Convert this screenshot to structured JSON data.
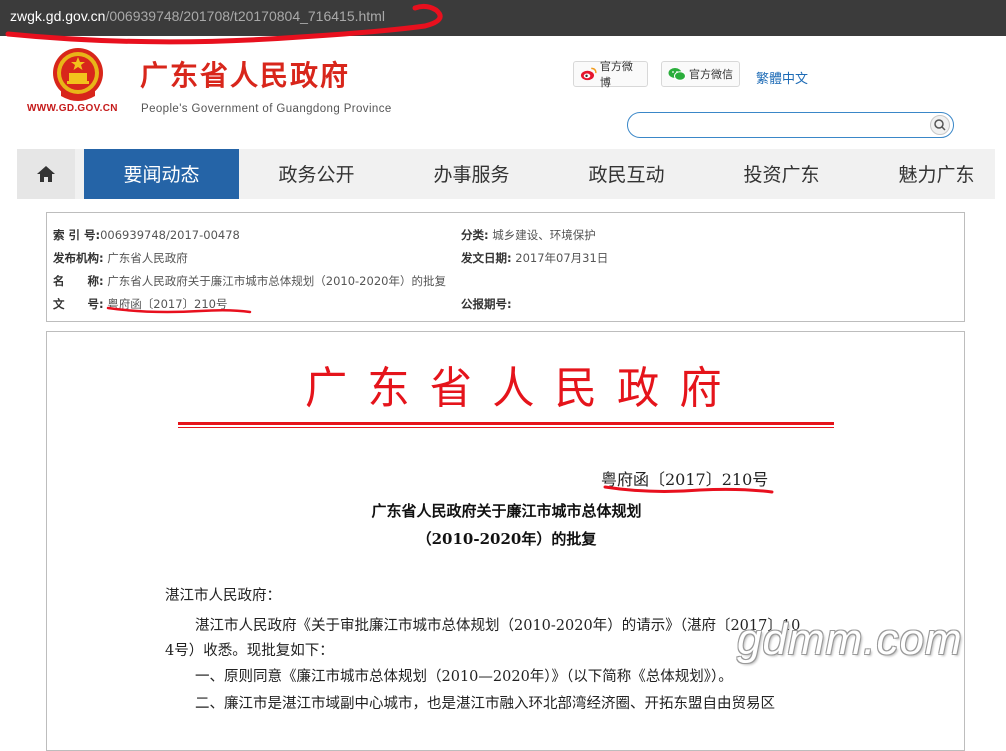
{
  "browser": {
    "url_host": "zwgk.gd.gov.cn",
    "url_path": "/006939748/201708/t20170804_716415.html"
  },
  "header": {
    "site_url": "WWW.GD.GOV.CN",
    "title": "广东省人民政府",
    "subtitle": "People's Government of Guangdong Province",
    "weibo_label": "官方微博",
    "weixin_label": "官方微信",
    "lang_link": "繁體中文",
    "search": {
      "value": "",
      "placeholder": ""
    }
  },
  "nav": {
    "items": [
      {
        "label": "要闻动态",
        "active": true
      },
      {
        "label": "政务公开",
        "active": false
      },
      {
        "label": "办事服务",
        "active": false
      },
      {
        "label": "政民互动",
        "active": false
      },
      {
        "label": "投资广东",
        "active": false
      },
      {
        "label": "魅力广东",
        "active": false
      }
    ]
  },
  "meta": {
    "index_key": "索 引 号:",
    "index_val": "006939748/2017-00478",
    "category_key": "分类:",
    "category_val": "城乡建设、环境保护",
    "issuer_key": "发布机构:",
    "issuer_val": "广东省人民政府",
    "date_key": "发文日期:",
    "date_val": "2017年07月31日",
    "name_key": "名　　称:",
    "name_val": "广东省人民政府关于廉江市城市总体规划（2010-2020年）的批复",
    "docno_key": "文　　号:",
    "docno_val": "粤府函〔2017〕210号",
    "gazette_key": "公报期号:",
    "gazette_val": ""
  },
  "document": {
    "red_header": "广东省人民政府",
    "doc_number": "粤府函〔2017〕210号",
    "title_line1": "广东省人民政府关于廉江市城市总体规划",
    "title_line2": "（2010-2020年）的批复",
    "salutation": "湛江市人民政府：",
    "para1_line1": "湛江市人民政府《关于审批廉江市城市总体规划（2010-2020年）的请示》（湛府〔2017〕10",
    "para1_line2": "4号）收悉。现批复如下：",
    "item1": "一、原则同意《廉江市城市总体规划（2010—2020年）》（以下简称《总体规划》）。",
    "item2_partial": "二、廉江市是湛江市域副中心城市，也是湛江市融入环北部湾经济圈、开拓东盟自由贸易区"
  },
  "watermark": "gdmm.com",
  "colors": {
    "brand_red": "#d8261b",
    "nav_active": "#2564a7",
    "link_blue": "#1d6bb6",
    "annotation_red": "#e8101e"
  },
  "icons": {
    "home": "home-icon",
    "weibo": "weibo-icon",
    "weixin": "wechat-icon",
    "search": "search-icon",
    "emblem": "national-emblem-icon"
  }
}
